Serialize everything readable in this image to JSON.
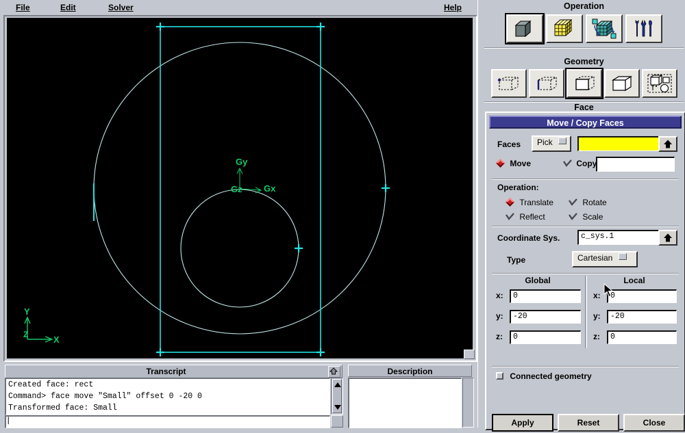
{
  "menubar": {
    "items": [
      {
        "label": "File",
        "mnemonic": "F"
      },
      {
        "label": "Edit",
        "mnemonic": "E"
      },
      {
        "label": "Solver",
        "mnemonic": "S"
      },
      {
        "label": "Help",
        "mnemonic": "H"
      }
    ],
    "file": "File",
    "edit": "Edit",
    "solver": "Solver",
    "help": "Help"
  },
  "graphics": {
    "background_color": "#000000",
    "edge_color": "#bfe8e8",
    "highlight_color": "#26e0e0",
    "axis_color": "#15c96a",
    "global_triad": {
      "x_label": "Gx",
      "y_label": "Gy",
      "z_label": "Gz"
    },
    "corner_triad": {
      "x_label": "X",
      "y_label": "Y",
      "z_label": "Z"
    }
  },
  "transcript": {
    "title": "Transcript",
    "lines": [
      "Created face: rect",
      "Command> face move \"Small\" offset 0 -20 0",
      "Transformed face: Small"
    ],
    "line0": "Created face: rect",
    "line1": "Command> face move \"Small\" offset 0 -20 0",
    "line2": "Transformed face: Small",
    "input_value": ""
  },
  "description": {
    "title": "Description",
    "content": ""
  },
  "operation": {
    "title": "Operation",
    "buttons": [
      {
        "name": "geometry",
        "icon": "gray-cube-icon",
        "selected": true
      },
      {
        "name": "mesh",
        "icon": "yellow-mesh-cube-icon",
        "selected": false
      },
      {
        "name": "zones",
        "icon": "teal-zones-cube-icon",
        "selected": false
      },
      {
        "name": "tools",
        "icon": "tools-icon",
        "selected": false
      }
    ]
  },
  "geometry": {
    "title": "Geometry",
    "buttons": [
      {
        "name": "vertex",
        "icon": "vertex-icon",
        "selected": false
      },
      {
        "name": "edge",
        "icon": "edge-icon",
        "selected": false
      },
      {
        "name": "face",
        "icon": "face-icon",
        "selected": true
      },
      {
        "name": "volume",
        "icon": "volume-icon",
        "selected": false
      },
      {
        "name": "group",
        "icon": "group-icon",
        "selected": false
      }
    ]
  },
  "face_section": {
    "title": "Face"
  },
  "dialog": {
    "title": "Move / Copy Faces",
    "faces": {
      "label": "Faces",
      "pick_label": "Pick",
      "value": "",
      "placeholder": "",
      "uparrow_icon": "up-arrow-icon"
    },
    "mode": {
      "move_label": "Move",
      "move_selected": true,
      "copy_label": "Copy",
      "copy_selected": false,
      "copy_value": ""
    },
    "operation": {
      "label": "Operation:",
      "options": [
        {
          "label": "Translate",
          "selected": true
        },
        {
          "label": "Rotate",
          "selected": false
        },
        {
          "label": "Reflect",
          "selected": false
        },
        {
          "label": "Scale",
          "selected": false
        }
      ],
      "translate": "Translate",
      "rotate": "Rotate",
      "reflect": "Reflect",
      "scale": "Scale"
    },
    "coordinate_sys": {
      "label": "Coordinate Sys.",
      "value": "c_sys.1",
      "uparrow_icon": "up-arrow-icon"
    },
    "type": {
      "label": "Type",
      "value": "Cartesian"
    },
    "global": {
      "header": "Global",
      "x_label": "x:",
      "x_value": "0",
      "y_label": "y:",
      "y_value": "-20",
      "z_label": "z:",
      "z_value": "0"
    },
    "local": {
      "header": "Local",
      "x_label": "x:",
      "x_value": "0",
      "y_label": "y:",
      "y_value": "-20",
      "z_label": "z:",
      "z_value": "0"
    },
    "connected_geometry": {
      "label": "Connected geometry",
      "checked": false
    },
    "buttons": {
      "apply": "Apply",
      "reset": "Reset",
      "close": "Close"
    }
  },
  "colors": {
    "face_bg": "#c3c7cf",
    "dialog_title_bg": "#3b3b8f",
    "highlight_field": "#ffff00",
    "radio_selected": "#cf2020"
  }
}
